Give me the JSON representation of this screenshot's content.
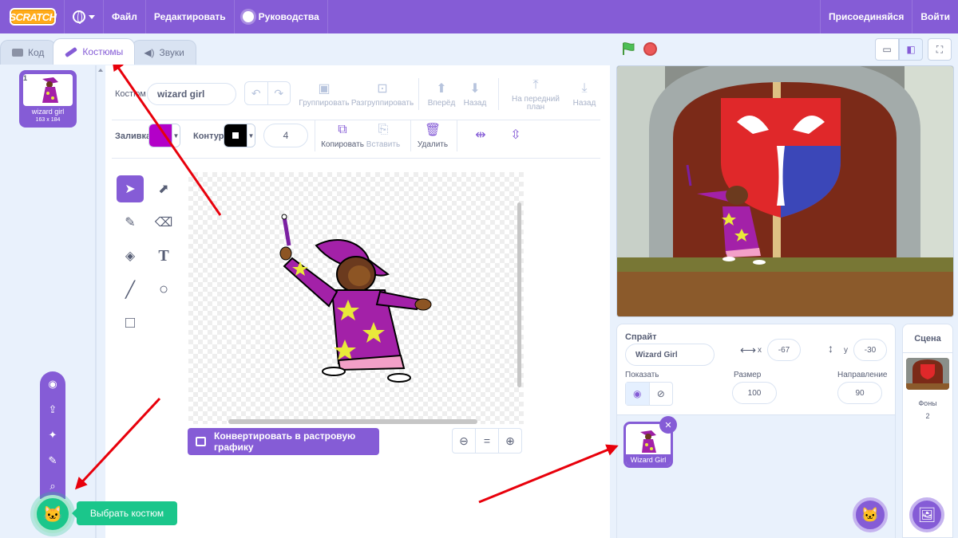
{
  "menubar": {
    "logo": "SCRATCH",
    "file": "Файл",
    "edit": "Редактировать",
    "tutorials": "Руководства",
    "join": "Присоединяйся",
    "signin": "Войти"
  },
  "tabs": [
    {
      "label": "Код"
    },
    {
      "label": "Костюмы"
    },
    {
      "label": "Звуки"
    }
  ],
  "costume_list": [
    {
      "number": "1",
      "name": "wizard girl",
      "size": "163 x 184"
    }
  ],
  "editor": {
    "costume_label": "Костюм",
    "costume_name": "wizard girl",
    "group": "Группировать",
    "ungroup": "Разгруппировать",
    "forward": "Вперёд",
    "backward": "Назад",
    "front": "На передний план",
    "back": "Назад",
    "fill_label": "Заливка",
    "fill_color": "#b300c8",
    "outline_label": "Контур",
    "outline_color": "#000000",
    "outline_width": "4",
    "copy": "Копировать",
    "paste": "Вставить",
    "delete": "Удалить",
    "convert": "Конвертировать в растровую графику",
    "zoom_reset": "="
  },
  "costume_menu": {
    "tooltip": "Выбрать костюм"
  },
  "sprite_info": {
    "sprite_label": "Спрайт",
    "sprite_name": "Wizard Girl",
    "x_label": "x",
    "x_value": "-67",
    "y_label": "y",
    "y_value": "-30",
    "show_label": "Показать",
    "size_label": "Размер",
    "size_value": "100",
    "direction_label": "Направление",
    "direction_value": "90"
  },
  "sprites": [
    {
      "name": "Wizard Girl"
    }
  ],
  "stage_panel": {
    "title": "Сцена",
    "backdrops_label": "Фоны",
    "backdrops_count": "2"
  },
  "colors": {
    "accent": "#855cd6",
    "green": "#1bc68b",
    "annotation": "#e8000b"
  }
}
